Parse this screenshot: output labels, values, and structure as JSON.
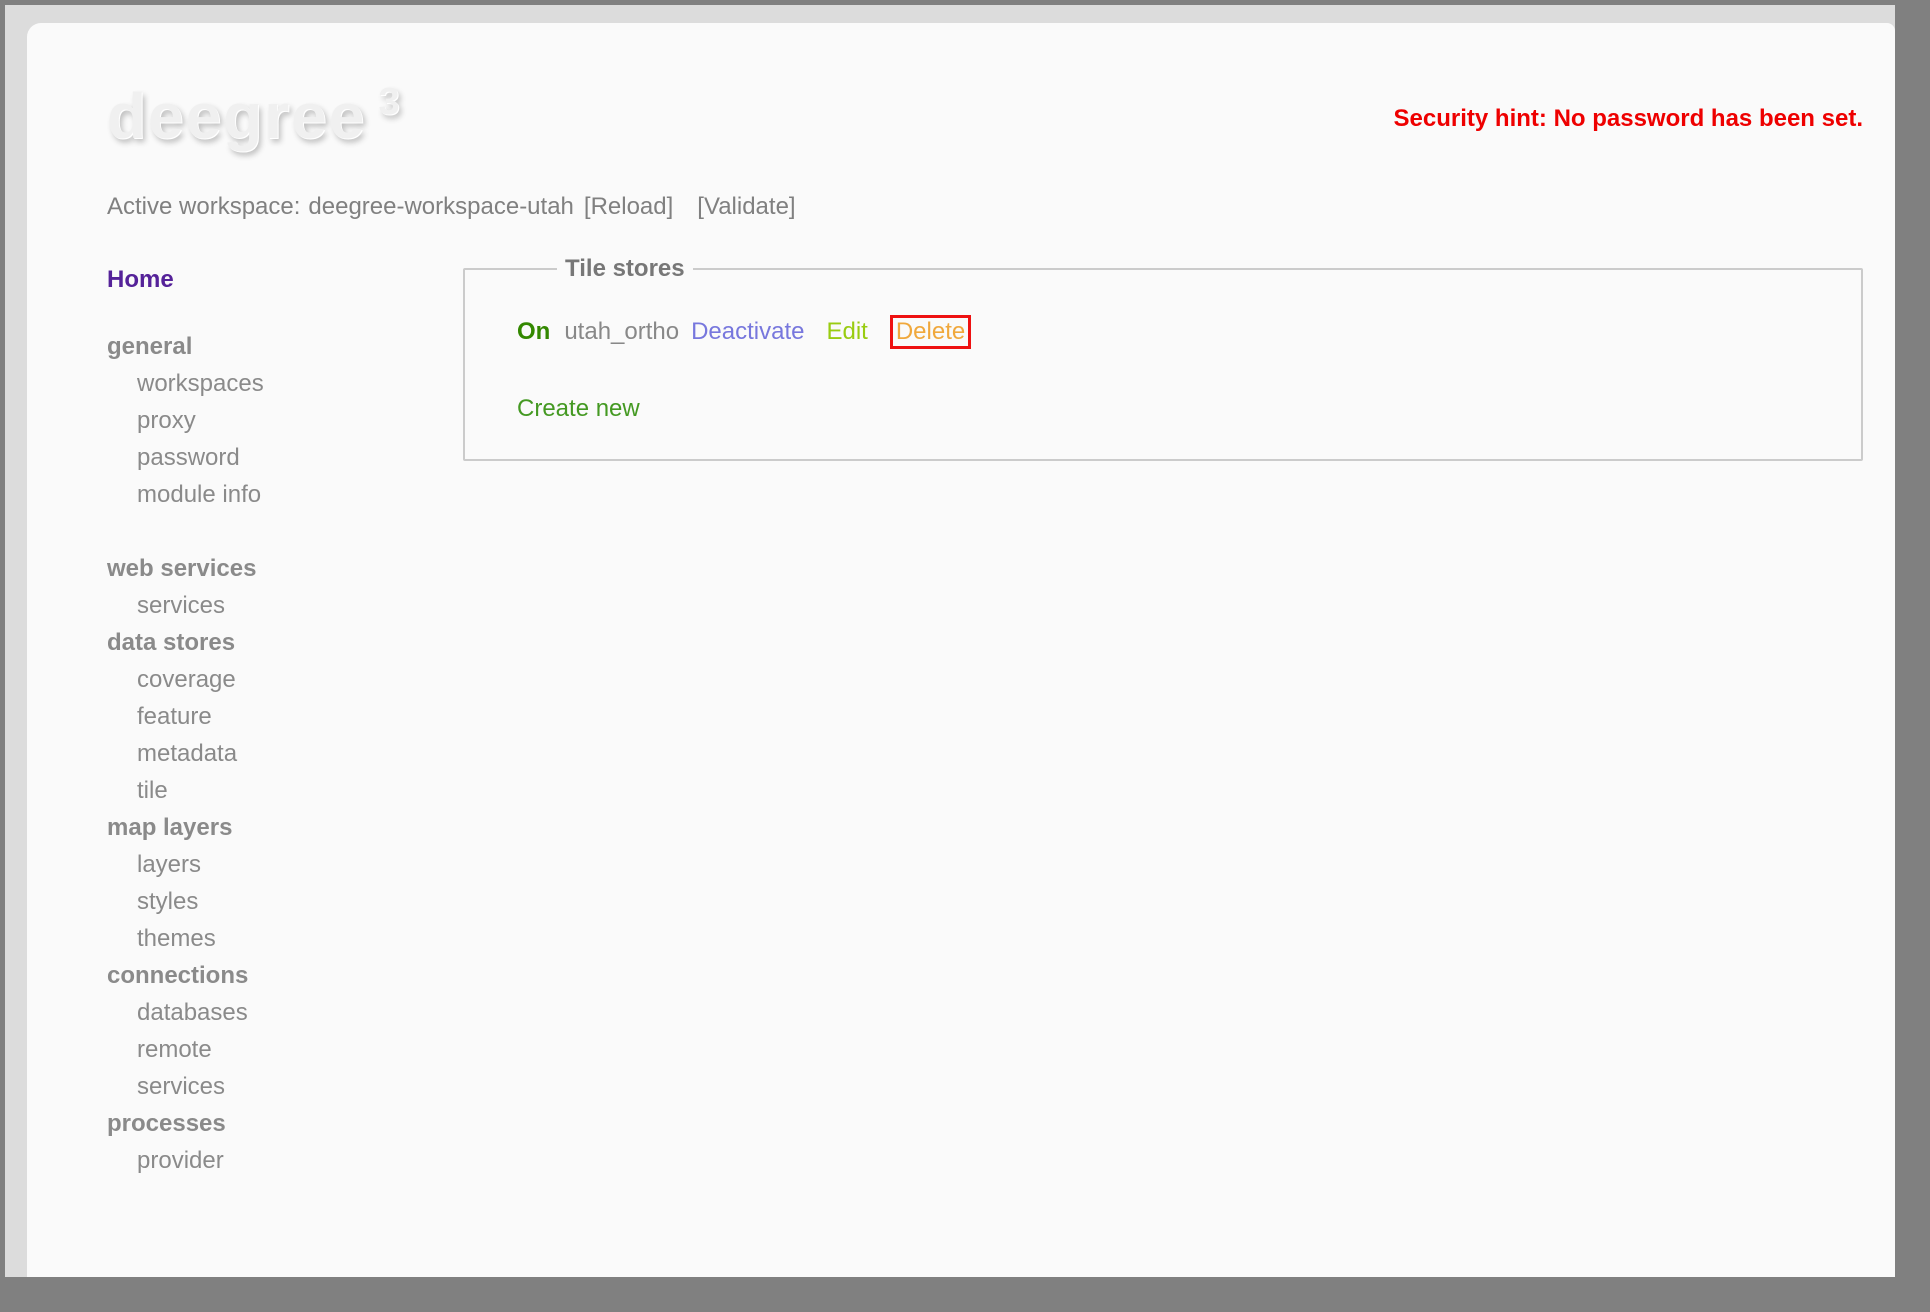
{
  "header": {
    "logo_text": "deegree",
    "logo_sup": "3",
    "security_hint": "Security hint: No password has been set."
  },
  "workspace": {
    "label": "Active workspace:",
    "name": "deegree-workspace-utah",
    "reload_label": "[Reload]",
    "validate_label": "[Validate]"
  },
  "sidebar": {
    "home_label": "Home",
    "sections": [
      {
        "header": "general",
        "gap_before": false,
        "items": [
          "workspaces",
          "proxy",
          "password",
          "module info"
        ]
      },
      {
        "header": "web services",
        "gap_before": true,
        "items": [
          "services"
        ]
      },
      {
        "header": "data stores",
        "gap_before": false,
        "items": [
          "coverage",
          "feature",
          "metadata",
          "tile"
        ]
      },
      {
        "header": "map layers",
        "gap_before": false,
        "items": [
          "layers",
          "styles",
          "themes"
        ]
      },
      {
        "header": "connections",
        "gap_before": false,
        "items": [
          "databases",
          "remote",
          "services"
        ]
      },
      {
        "header": "processes",
        "gap_before": false,
        "items": [
          "provider"
        ]
      }
    ]
  },
  "panel": {
    "legend": "Tile stores",
    "rows": [
      {
        "status": "On",
        "name": "utah_ortho",
        "actions": [
          {
            "label": "Deactivate",
            "kind": "deactivate",
            "highlighted": false
          },
          {
            "label": "Edit",
            "kind": "edit",
            "highlighted": false
          },
          {
            "label": "Delete",
            "kind": "delete",
            "highlighted": true
          }
        ]
      }
    ],
    "create_label": "Create new"
  },
  "colors": {
    "page_background": "#fafafa",
    "frame_gray": "#808080",
    "band_gray": "#dcdcdc",
    "text_gray": "#8a8a8a",
    "home_purple": "#552299",
    "hint_red": "#ee0000",
    "status_on_green": "#338800",
    "deactivate_blue": "#7777dd",
    "edit_yellow_green": "#99cc11",
    "delete_orange": "#f0a83c",
    "delete_border_red": "#ee1111",
    "create_green": "#449922",
    "legend_gray": "#777777"
  }
}
